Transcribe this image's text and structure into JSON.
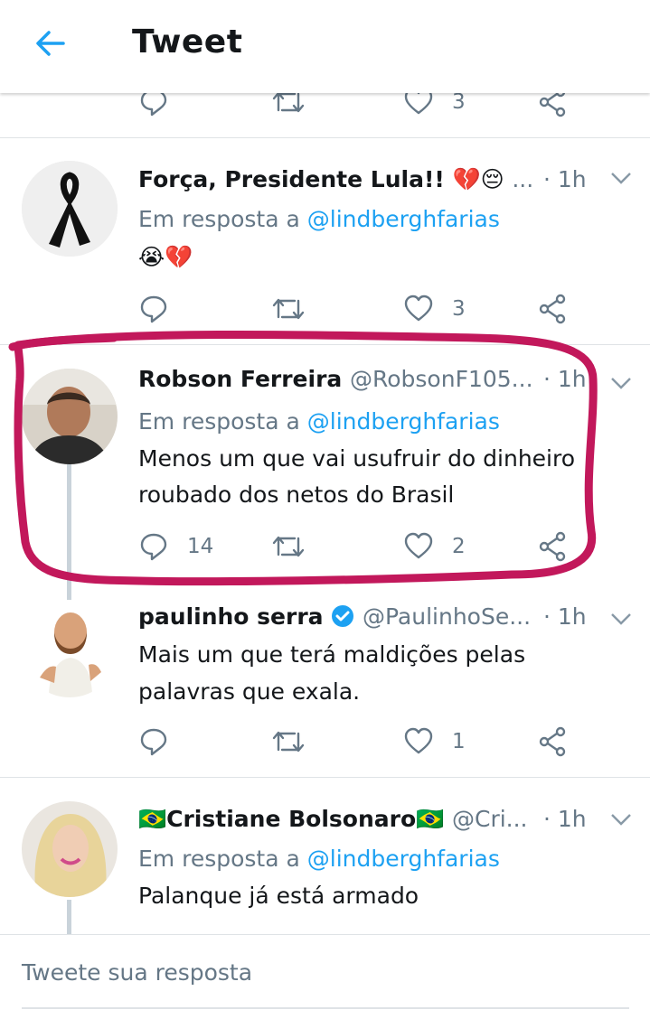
{
  "header": {
    "title": "Tweet",
    "back_icon": "arrow-left-icon"
  },
  "top_actions": {
    "like_count": "3"
  },
  "tweets": [
    {
      "name": "Força, Presidente Lula!! 💔😔",
      "handle": "...",
      "time": "· 1h",
      "reply_prefix": "Em resposta a",
      "reply_to": "@lindberghfarias",
      "text_lines": [
        "😭💔"
      ],
      "reply_count": "",
      "like_count": "3"
    },
    {
      "name": "Robson Ferreira",
      "handle": "@RobsonF105...",
      "time": "· 1h",
      "reply_prefix": "Em resposta a",
      "reply_to": "@lindberghfarias",
      "text_lines": [
        "Menos um que vai usufruir do dinheiro",
        "roubado dos netos do Brasil"
      ],
      "reply_count": "14",
      "like_count": "2"
    },
    {
      "name": "paulinho serra",
      "handle": "@PaulinhoSe...",
      "time": "· 1h",
      "text_lines": [
        "Mais um que terá maldições pelas",
        "palavras que exala."
      ],
      "reply_count": "",
      "like_count": "1",
      "verified": true
    },
    {
      "name": "🇧🇷Cristiane Bolsonaro🇧🇷",
      "handle": "@Cri...",
      "time": "· 1h",
      "reply_prefix": "Em resposta a",
      "reply_to": "@lindberghfarias",
      "text_lines": [
        "Palanque já está armado"
      ]
    }
  ],
  "compose": {
    "placeholder": "Tweete sua resposta"
  },
  "colors": {
    "accent": "#1da1f2",
    "muted": "#657786",
    "highlight": "#c2185b"
  }
}
